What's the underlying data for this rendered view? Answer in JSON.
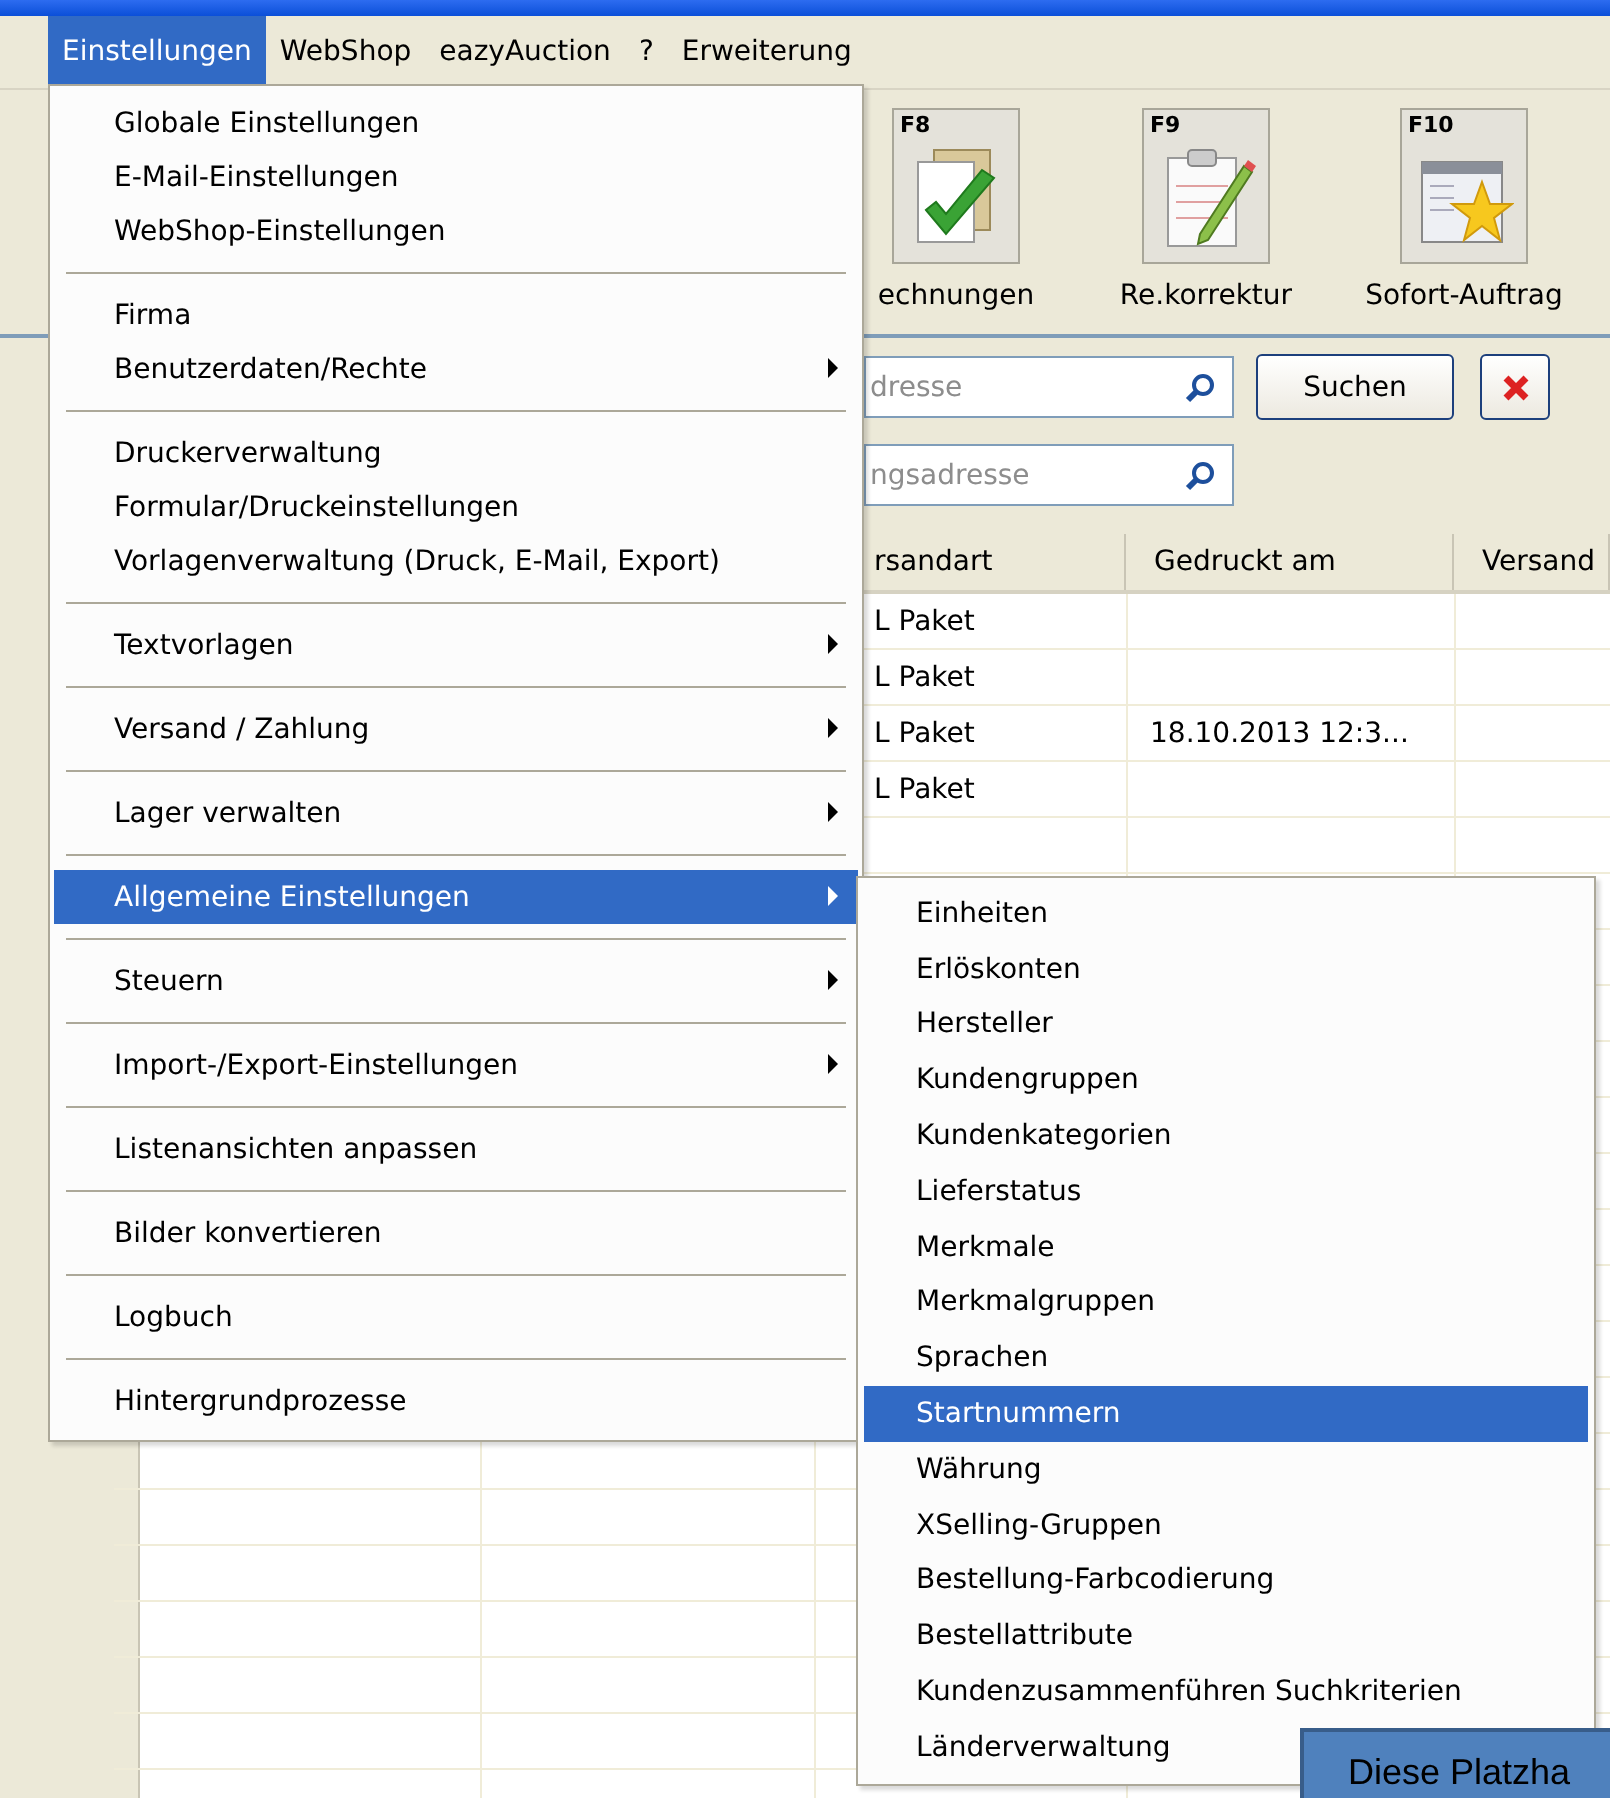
{
  "menubar": [
    {
      "label": "Einstellungen",
      "selected": true
    },
    {
      "label": "WebShop",
      "selected": false
    },
    {
      "label": "eazyAuction",
      "selected": false
    },
    {
      "label": "?",
      "selected": false
    },
    {
      "label": "Erweiterung",
      "selected": false
    }
  ],
  "toolbar": [
    {
      "kind": "invoice",
      "key": "F8",
      "label": "echnungen"
    },
    {
      "kind": "correction",
      "key": "F9",
      "label": "Re.korrektur"
    },
    {
      "kind": "order",
      "key": "F10",
      "label": "Sofort-Auftrag"
    }
  ],
  "search_fields": [
    {
      "placeholder": "dresse"
    },
    {
      "placeholder": "ngsadresse"
    }
  ],
  "search_button": "Suchen",
  "table": {
    "columns": [
      "rsandart",
      "Gedruckt am",
      "Versand"
    ],
    "rows": [
      {
        "cells": [
          "L Paket"
        ]
      },
      {
        "cells": [
          "L Paket"
        ]
      },
      {
        "cells": [
          "L Paket",
          "18.10.2013 12:3..."
        ]
      },
      {
        "cells": [
          "L Paket"
        ]
      }
    ]
  },
  "menu": {
    "items": [
      {
        "kind": "item",
        "label": "Globale Einstellungen",
        "has_submenu": false,
        "selected": false
      },
      {
        "kind": "item",
        "label": "E-Mail-Einstellungen",
        "has_submenu": false,
        "selected": false
      },
      {
        "kind": "item",
        "label": "WebShop-Einstellungen",
        "has_submenu": false,
        "selected": false
      },
      {
        "kind": "separator"
      },
      {
        "kind": "item",
        "label": "Firma",
        "has_submenu": false,
        "selected": false
      },
      {
        "kind": "item",
        "label": "Benutzerdaten/Rechte",
        "has_submenu": true,
        "selected": false
      },
      {
        "kind": "separator"
      },
      {
        "kind": "item",
        "label": "Druckerverwaltung",
        "has_submenu": false,
        "selected": false
      },
      {
        "kind": "item",
        "label": "Formular/Druckeinstellungen",
        "has_submenu": false,
        "selected": false
      },
      {
        "kind": "item",
        "label": "Vorlagenverwaltung (Druck, E-Mail, Export)",
        "has_submenu": false,
        "selected": false
      },
      {
        "kind": "separator"
      },
      {
        "kind": "item",
        "label": "Textvorlagen",
        "has_submenu": true,
        "selected": false
      },
      {
        "kind": "separator"
      },
      {
        "kind": "item",
        "label": "Versand / Zahlung",
        "has_submenu": true,
        "selected": false
      },
      {
        "kind": "separator"
      },
      {
        "kind": "item",
        "label": "Lager verwalten",
        "has_submenu": true,
        "selected": false
      },
      {
        "kind": "separator"
      },
      {
        "kind": "item",
        "label": "Allgemeine Einstellungen",
        "has_submenu": true,
        "selected": true
      },
      {
        "kind": "separator"
      },
      {
        "kind": "item",
        "label": "Steuern",
        "has_submenu": true,
        "selected": false
      },
      {
        "kind": "separator"
      },
      {
        "kind": "item",
        "label": "Import-/Export-Einstellungen",
        "has_submenu": true,
        "selected": false
      },
      {
        "kind": "separator"
      },
      {
        "kind": "item",
        "label": "Listenansichten anpassen",
        "has_submenu": false,
        "selected": false
      },
      {
        "kind": "separator"
      },
      {
        "kind": "item",
        "label": "Bilder konvertieren",
        "has_submenu": false,
        "selected": false
      },
      {
        "kind": "separator"
      },
      {
        "kind": "item",
        "label": "Logbuch",
        "has_submenu": false,
        "selected": false
      },
      {
        "kind": "separator"
      },
      {
        "kind": "item",
        "label": "Hintergrundprozesse",
        "has_submenu": false,
        "selected": false
      }
    ]
  },
  "submenu": {
    "items": [
      {
        "label": "Einheiten",
        "selected": false
      },
      {
        "label": "Erlöskonten",
        "selected": false
      },
      {
        "label": "Hersteller",
        "selected": false
      },
      {
        "label": "Kundengruppen",
        "selected": false
      },
      {
        "label": "Kundenkategorien",
        "selected": false
      },
      {
        "label": "Lieferstatus",
        "selected": false
      },
      {
        "label": "Merkmale",
        "selected": false
      },
      {
        "label": "Merkmalgruppen",
        "selected": false
      },
      {
        "label": "Sprachen",
        "selected": false
      },
      {
        "label": "Startnummern",
        "selected": true
      },
      {
        "label": "Währung",
        "selected": false
      },
      {
        "label": "XSelling-Gruppen",
        "selected": false
      },
      {
        "label": "Bestellung-Farbcodierung",
        "selected": false
      },
      {
        "label": "Bestellattribute",
        "selected": false
      },
      {
        "label": "Kundenzusammenführen Suchkriterien",
        "selected": false
      },
      {
        "label": "Länderverwaltung",
        "selected": false
      }
    ]
  },
  "callout": "Diese Platzha"
}
